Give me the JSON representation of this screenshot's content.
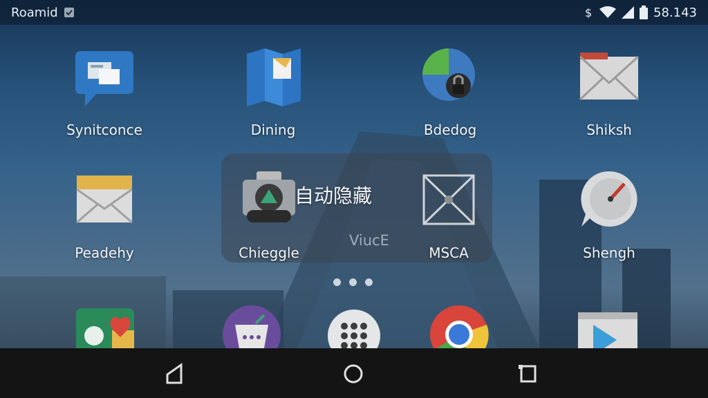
{
  "status_bar": {
    "carrier": "Roamid",
    "clock": "58.143",
    "icons": [
      "check-icon",
      "data-icon",
      "wifi-icon",
      "signal-icon",
      "battery-icon"
    ]
  },
  "home": {
    "row1": [
      {
        "label": "Synitconce",
        "icon": "chat-icon"
      },
      {
        "label": "Dining",
        "icon": "map-icon"
      },
      {
        "label": "Bdedog",
        "icon": "lock-icon"
      },
      {
        "label": "Shiksh",
        "icon": "mail-icon"
      }
    ],
    "row2": [
      {
        "label": "Peadehy",
        "icon": "envelope-icon"
      },
      {
        "label": "Chieggle",
        "icon": "camera-icon"
      },
      {
        "label": "MSCA",
        "icon": "frame-icon"
      },
      {
        "label": "Shengh",
        "icon": "clock-icon"
      }
    ]
  },
  "popup": {
    "title": "自动隐藏",
    "subtitle": "ViucE"
  },
  "page_indicator": {
    "count": 3
  },
  "dock": [
    {
      "icon": "heart-icon"
    },
    {
      "icon": "cart-icon"
    },
    {
      "icon": "app-drawer-icon"
    },
    {
      "icon": "chrome-icon"
    },
    {
      "icon": "play-store-icon"
    }
  ]
}
